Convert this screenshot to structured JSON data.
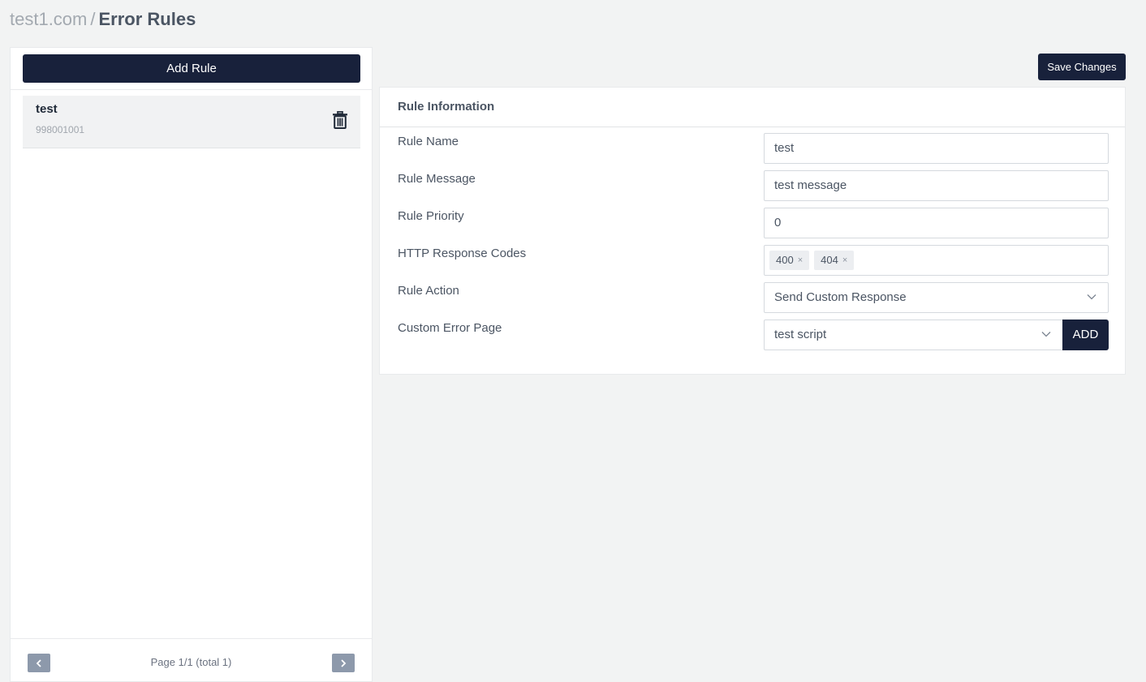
{
  "breadcrumb": {
    "domain": "test1.com",
    "separator": "/",
    "title": "Error Rules"
  },
  "left_panel": {
    "add_rule_label": "Add Rule",
    "rules": [
      {
        "name": "test",
        "id": "998001001"
      }
    ],
    "pagination": {
      "text": "Page 1/1 (total 1)"
    }
  },
  "toolbar": {
    "save_label": "Save Changes"
  },
  "rule_info": {
    "title": "Rule Information",
    "fields": {
      "name": {
        "label": "Rule Name",
        "value": "test"
      },
      "message": {
        "label": "Rule Message",
        "value": "test message"
      },
      "priority": {
        "label": "Rule Priority",
        "value": "0"
      },
      "codes": {
        "label": "HTTP Response Codes",
        "tags": [
          "400",
          "404"
        ],
        "remove_glyph": "×"
      },
      "action": {
        "label": "Rule Action",
        "value": "Send Custom Response"
      },
      "error_page": {
        "label": "Custom Error Page",
        "value": "test script",
        "add_label": "ADD"
      }
    }
  },
  "icons": {
    "trash": "trash-icon",
    "chevron_left": "chevron-left-icon",
    "chevron_right": "chevron-right-icon",
    "chevron_down": "chevron-down-icon"
  },
  "colors": {
    "primary": "#18213b",
    "pager": "#8d99ab",
    "background": "#f2f3f3"
  }
}
